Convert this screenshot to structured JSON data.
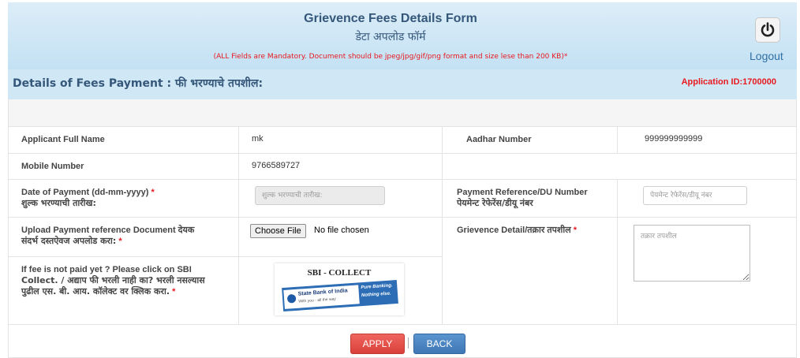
{
  "header": {
    "title": "Grievence Fees Details Form",
    "subtitle": "डेटा अपलोड फॉर्म",
    "note": "(ALL Fields are Mandatory. Document should be jpeg/jpg/gif/png format and size lese than 200 KB)*",
    "logout_label": "Logout",
    "logout_icon": "power-icon"
  },
  "section": {
    "title": "Details of Fees Payment : फी भरण्याचे तपशील:",
    "application_id": "Application ID:1700000"
  },
  "fields": {
    "full_name": {
      "label": "Applicant Full Name",
      "value": "mk"
    },
    "aadhar": {
      "label": "Aadhar Number",
      "value": "999999999999"
    },
    "mobile": {
      "label": "Mobile Number",
      "value": "9766589727"
    },
    "payment_date": {
      "label": "Date of Payment (dd-mm-yyyy)",
      "label_marathi": "शुल्क भरण्याची तारीख:",
      "required": "*",
      "placeholder": "शुल्क भरण्याची तारीख:"
    },
    "payment_ref": {
      "label": "Payment Reference/DU Number",
      "label_marathi": "पेयमेन्ट रेफेरेंस/डीयू नंबर",
      "placeholder": "पेयमेन्ट रेफेरेंस/डीयू नंबर"
    },
    "upload": {
      "label": "Upload Payment reference Document देयक",
      "label_marathi": "संदर्भ दस्तऐवज अपलोड करा:",
      "required": "*",
      "button_label": "Choose File",
      "status": "No file chosen"
    },
    "grievance": {
      "label": "Grievence Detail/तक्रार तपशील",
      "required": "*",
      "placeholder": "तक्रार तपशील"
    },
    "sbi_collect": {
      "line1": "If fee is not paid yet ? Please click on SBI",
      "line2": "Collect. / अद्याप फी भरली नाही का? भरली नसल्यास",
      "line3": "पुढील एस. बी. आय. कॉलेक्ट वर क्लिक करा.",
      "required": "*",
      "badge_title": "SBI - COLLECT",
      "badge_bank": "State Bank of India",
      "badge_tagline": "With you - all the way",
      "badge_promo1": "Pure Banking.",
      "badge_promo2": "Nothing else."
    }
  },
  "actions": {
    "apply_label": "APPLY",
    "back_label": "BACK"
  },
  "colors": {
    "title": "#35577a",
    "alert_red": "#e8181e",
    "header_bg": "#c3e1f3",
    "apply_bg": "#e5504a",
    "back_bg": "#4a86c4"
  }
}
